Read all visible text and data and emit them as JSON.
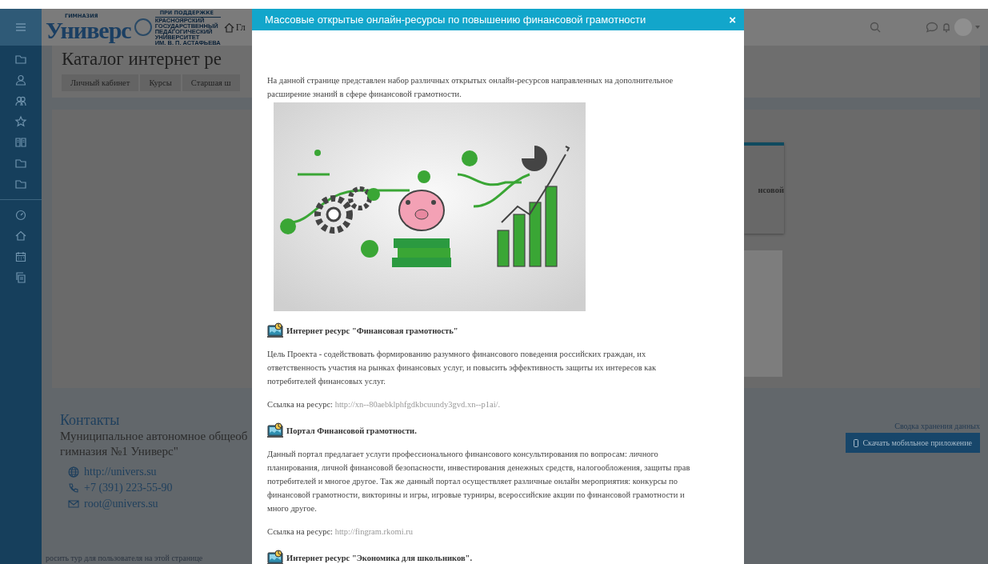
{
  "header": {
    "logo": {
      "top_label": "ГИМНАЗИЯ",
      "name": "Универс",
      "support_label": "ПРИ ПОДДЕРЖКЕ",
      "partner_lines": [
        "КРАСНОЯРСКИЙ",
        "ГОСУДАРСТВЕННЫЙ",
        "ПЕДАГОГИЧЕСКИЙ",
        "УНИВЕРСИТЕТ",
        "ИМ. В. П. АСТАФЬЕВА"
      ]
    },
    "home_link": "Гл"
  },
  "page": {
    "title": "Каталог интернет ре",
    "breadcrumbs": [
      "Личный кабинет",
      "Курсы",
      "Старшая ш"
    ],
    "card_text": "нсовой"
  },
  "footer": {
    "contacts_title": "Контакты",
    "organization_lines": [
      "Муниципальное автономное общеоб",
      "гимназия №1 Универс\""
    ],
    "contacts": [
      {
        "kind": "web",
        "text": "http://univers.su"
      },
      {
        "kind": "phone",
        "text": "+7 (391) 223-55-90"
      },
      {
        "kind": "email",
        "text": "root@univers.su"
      }
    ],
    "data_summary": "Сводка хранения данных",
    "app_button": "Скачать мобильное приложение",
    "tour_link": "росить тур для пользователя на этой странице"
  },
  "modal": {
    "title": "Массовые открытые онлайн-ресурсы по повышению финансовой грамотности",
    "close": "×",
    "intro": "На данной странице представлен набор различных открытых онлайн-ресурсов направленных на дополнительное расширение знаний в сфере финансовой грамотности.",
    "sections": [
      {
        "heading": "Интернет ресурс \"Финансовая грамотность\"",
        "description": "Цель Проекта - содействовать формированию разумного финансового поведения российских граждан, их ответственность участия на рынках финансовых услуг, и повысить эффективность защиты их интересов как потребителей финансовых услуг.",
        "link_label": "Ссылка на ресурс:",
        "url": "http://xn--80aebklphfgdkbcuundy3gvd.xn--p1ai/."
      },
      {
        "heading": "Портал Финансовой грамотности.",
        "description": "Данный портал предлагает услуги профессионального финансового консультирования по вопросам: личного планирования, личной финансовой безопасности, инвестирования денежных средств, налогообложения, защиты прав потребителей и многое другое. Так же данный портал осуществляет различные онлайн мероприятия: конкурсы по финансовой грамотности, викторины и игры, игровые турниры, всероссийские акции по финансовой грамотности и много другое.",
        "link_label": "Ссылка на ресурс:",
        "url": "http://fingram.rkomi.ru"
      },
      {
        "heading": "Интернет ресурс \"Экономика для школьников\"."
      }
    ]
  }
}
